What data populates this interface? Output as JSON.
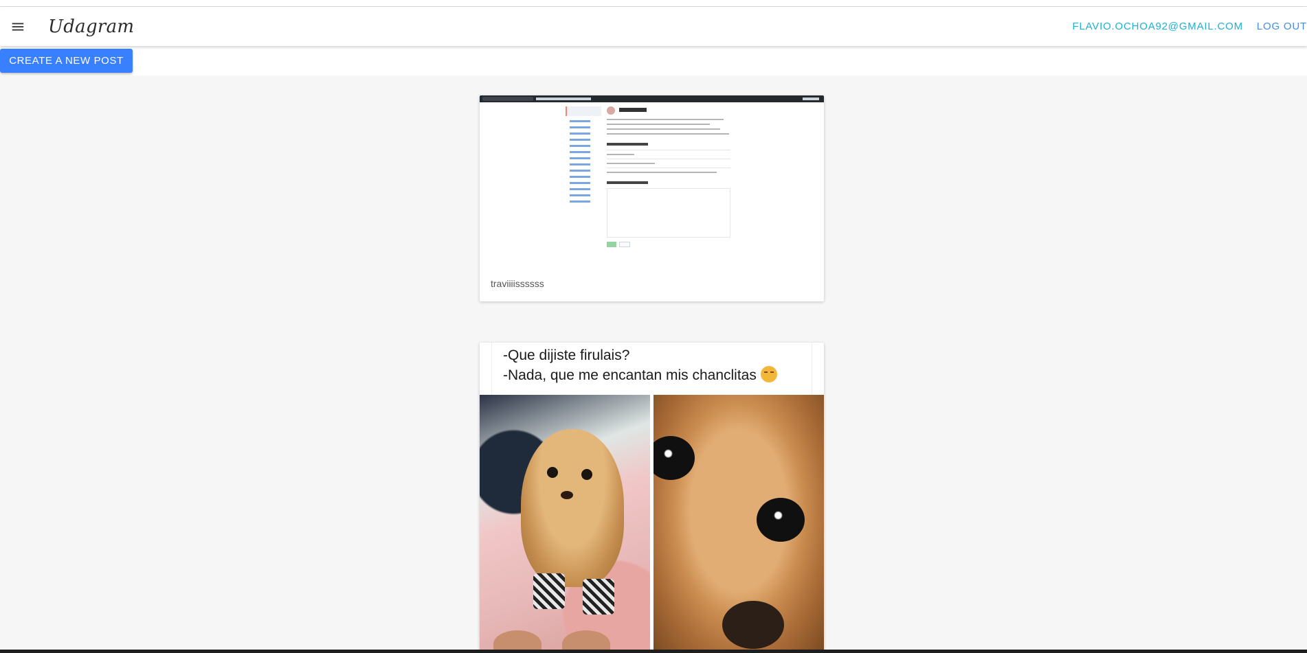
{
  "app": {
    "title": "Udagram"
  },
  "header": {
    "menu_icon": "menu-icon",
    "email": "FLAVIO.OCHOA92@GMAIL.COM",
    "logout_label": "LOG OUT",
    "email_color": "#1cb1d6",
    "logout_color": "#3f8ee6"
  },
  "actions": {
    "create_post_label": "CREATE A NEW POST",
    "create_post_color": "#3880ff"
  },
  "feed": {
    "posts": [
      {
        "caption": "traviiiissssss",
        "image": "screenshot-of-settings-page"
      },
      {
        "caption": "",
        "image": "chihuahua-meme",
        "meme_line_1": "-Que dijiste firulais?",
        "meme_line_2": "-Nada, que me encantan mis chanclitas",
        "meme_emoji": "smirking-face"
      }
    ]
  }
}
